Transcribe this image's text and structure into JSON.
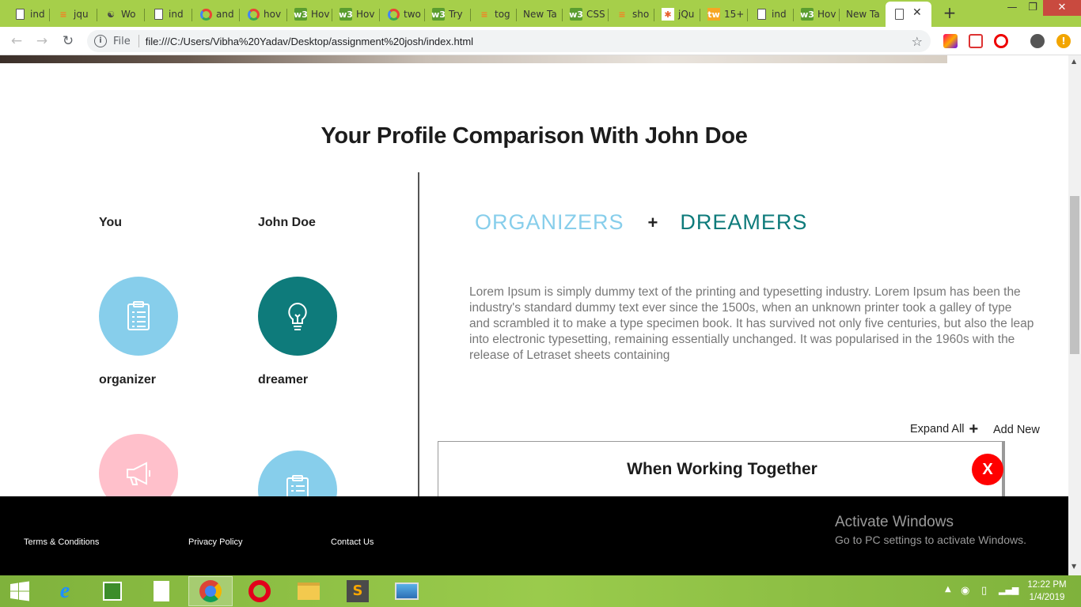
{
  "browser": {
    "tabs": [
      {
        "label": "ind",
        "icon": "document-icon"
      },
      {
        "label": "jqu",
        "icon": "stackoverflow-icon"
      },
      {
        "label": "Wo",
        "icon": "globe-icon"
      },
      {
        "label": "ind",
        "icon": "document-icon"
      },
      {
        "label": "and",
        "icon": "google-icon"
      },
      {
        "label": "hov",
        "icon": "google-icon"
      },
      {
        "label": "Hov",
        "icon": "w3schools-icon"
      },
      {
        "label": "Hov",
        "icon": "w3schools-icon"
      },
      {
        "label": "two",
        "icon": "google-icon"
      },
      {
        "label": "Try",
        "icon": "w3schools-icon"
      },
      {
        "label": "tog",
        "icon": "stackoverflow-icon"
      },
      {
        "label": "New Ta",
        "icon": "none"
      },
      {
        "label": "CSS",
        "icon": "w3schools-icon"
      },
      {
        "label": "sho",
        "icon": "stackoverflow-icon"
      },
      {
        "label": "jQu",
        "icon": "jquery-icon"
      },
      {
        "label": "15+",
        "icon": "tw-icon"
      },
      {
        "label": "ind",
        "icon": "document-icon"
      },
      {
        "label": "Hov",
        "icon": "w3schools-icon"
      },
      {
        "label": "New Ta",
        "icon": "none"
      },
      {
        "label": "",
        "icon": "document-icon"
      }
    ],
    "scheme_label": "File",
    "url": "file:///C:/Users/Vibha%20Yadav/Desktop/assignment%20josh/index.html"
  },
  "page": {
    "title": "Your Profile Comparison With John Doe",
    "left": {
      "col_you": "You",
      "col_john": "John Doe",
      "you_trait": "organizer",
      "john_trait": "dreamer"
    },
    "right": {
      "type_a": "ORGANIZERS",
      "plus": "+",
      "type_b": "DREAMERS",
      "description": "Lorem Ipsum is simply dummy text of the printing and typesetting industry. Lorem Ipsum has been the industry's standard dummy text ever since the 1500s, when an unknown printer took a galley of type and scrambled it to make a type specimen book. It has survived not only five centuries, but also the leap into electronic typesetting, remaining essentially unchanged. It was popularised in the 1960s with the release of Letraset sheets containing",
      "expand_all": "Expand All",
      "add_new": "Add New",
      "card_title": "When Working Together",
      "close_label": "X"
    },
    "colors": {
      "organizer": "#87ceeb",
      "dreamer": "#0e7b7b",
      "pink": "#ffc0cb",
      "close": "#ff0000"
    }
  },
  "footer": {
    "links": [
      "Terms & Conditions",
      "Privacy Policy",
      "Contact Us"
    ]
  },
  "watermark": {
    "heading": "Activate Windows",
    "sub": "Go to PC settings to activate Windows."
  },
  "taskbar": {
    "time": "12:22 PM",
    "date": "1/4/2019"
  }
}
